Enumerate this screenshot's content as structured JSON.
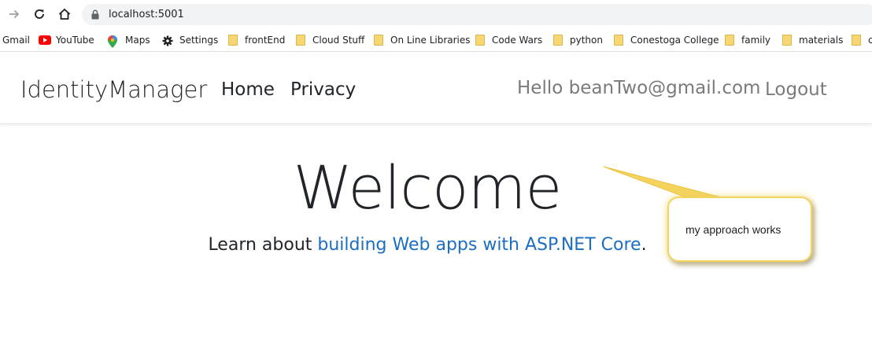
{
  "browser": {
    "url": "localhost:5001",
    "icons": [
      "forward-icon",
      "reload-icon",
      "home-icon",
      "lock-icon"
    ]
  },
  "bookmarks": [
    {
      "label": "Gmail",
      "icon": "gmail"
    },
    {
      "label": "YouTube",
      "icon": "youtube"
    },
    {
      "label": "Maps",
      "icon": "maps"
    },
    {
      "label": "Settings",
      "icon": "gear"
    },
    {
      "label": "frontEnd",
      "icon": "folder"
    },
    {
      "label": "Cloud Stuff",
      "icon": "folder"
    },
    {
      "label": "On Line Libraries",
      "icon": "folder"
    },
    {
      "label": "Code Wars",
      "icon": "folder"
    },
    {
      "label": "python",
      "icon": "folder"
    },
    {
      "label": "Conestoga College",
      "icon": "folder"
    },
    {
      "label": "family",
      "icon": "folder"
    },
    {
      "label": "materials",
      "icon": "folder"
    },
    {
      "label": "c",
      "icon": "folder"
    }
  ],
  "navbar": {
    "brand": "IdentityManager",
    "links": [
      "Home",
      "Privacy"
    ],
    "greeting": "Hello beanTwo@gmail.com",
    "logout": "Logout"
  },
  "main": {
    "heading": "Welcome",
    "lead_prefix": "Learn about ",
    "lead_link": "building Web apps with ASP.NET Core",
    "lead_suffix": "."
  },
  "callout": {
    "text": "my approach works"
  },
  "colors": {
    "link": "#1b6ec2",
    "callout_border": "#f4d35e",
    "muted": "#7a7a7a"
  }
}
